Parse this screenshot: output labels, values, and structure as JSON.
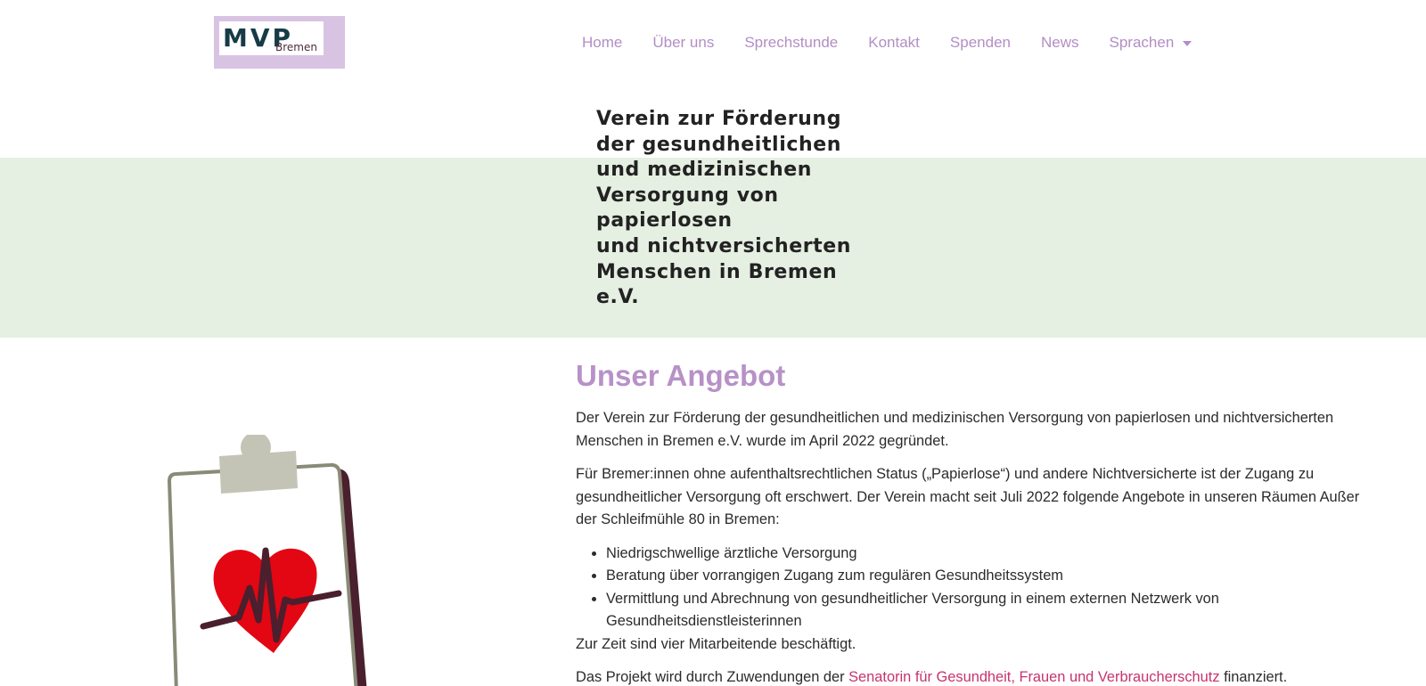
{
  "header": {
    "logo": {
      "main": "MVP",
      "sub": "Bremen"
    },
    "nav": [
      {
        "label": "Home"
      },
      {
        "label": "Über uns"
      },
      {
        "label": "Sprechstunde"
      },
      {
        "label": "Kontakt"
      },
      {
        "label": "Spenden"
      },
      {
        "label": "News"
      },
      {
        "label": "Sprachen"
      }
    ]
  },
  "hero": {
    "lines": [
      "Verein zur Förderung",
      "der gesundheitlichen",
      "und medizinischen",
      "Versorgung von",
      "papierlosen",
      "und nichtversicherten",
      "Menschen in Bremen",
      "e.V."
    ]
  },
  "main": {
    "title": "Unser Angebot",
    "p1": "Der Verein zur Förderung der gesundheitlichen und medizinischen Versorgung von papierlosen und nichtversicherten Menschen in Bremen e.V. wurde im April 2022 gegründet.",
    "p2": "Für Bremer:innen ohne aufenthaltsrechtlichen Status („Papierlose“) und andere Nichtversicherte ist der Zugang zu gesundheitlicher Versorgung oft erschwert. Der Verein macht seit Juli 2022 folgende Angebote in unseren Räumen Außer der Schleifmühle 80 in Bremen:",
    "list": [
      "Niedrigschwellige ärztliche Versorgung",
      "Beratung über vorrangigen Zugang zum regulären Gesundheitssystem",
      "Vermittlung und Abrechnung von gesundheitlicher Versorgung in einem externen Netzwerk von Gesundheitsdienstleisterinnen"
    ],
    "p3": "Zur Zeit sind vier Mitarbeitende beschäftigt.",
    "p4_prefix": "Das Projekt wird durch Zuwendungen der ",
    "p4_link": "Senatorin für Gesundheit, Frauen und Verbraucherschutz",
    "p4_suffix": " finanziert."
  },
  "colors": {
    "accent": "#b791c7",
    "nav": "#b28ec4",
    "hero_band": "#e5efe2",
    "link": "#c7336f",
    "heart": "#e30613"
  }
}
